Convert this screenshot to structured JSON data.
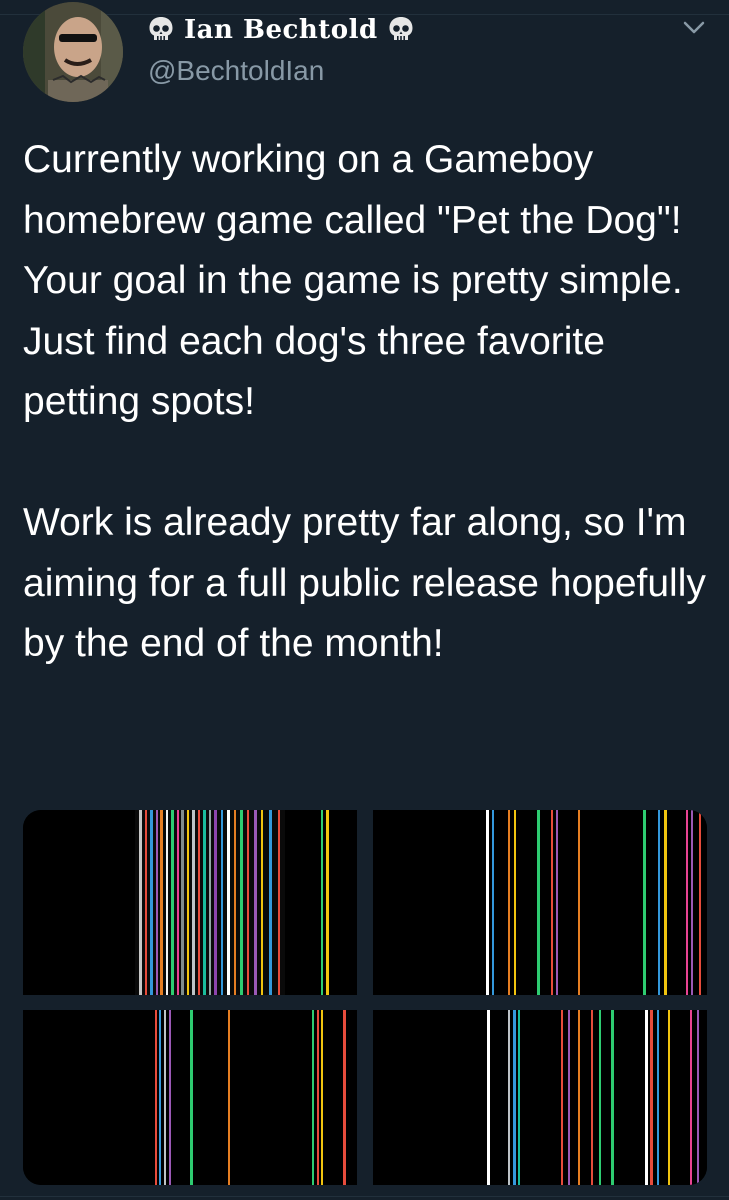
{
  "tweet": {
    "author": {
      "display_name": "Ian Bechtold",
      "handle": "@BechtoldIan",
      "avatar_icon": "profile-photo-icon",
      "decoration_icon": "skull-icon"
    },
    "menu_icon": "chevron-down-icon",
    "paragraphs": [
      "Currently working on a Gameboy homebrew game called \"Pet the Dog\"! Your goal in the game is pretty simple. Just find each dog's three favorite petting spots!",
      "Work is already pretty far along, so I'm aiming for a full public release hopefully by the end of the month!"
    ],
    "media_count": 4
  },
  "colors": {
    "background": "#15202b",
    "text_primary": "#ffffff",
    "text_secondary": "#8899a6",
    "border": "#22303c"
  }
}
